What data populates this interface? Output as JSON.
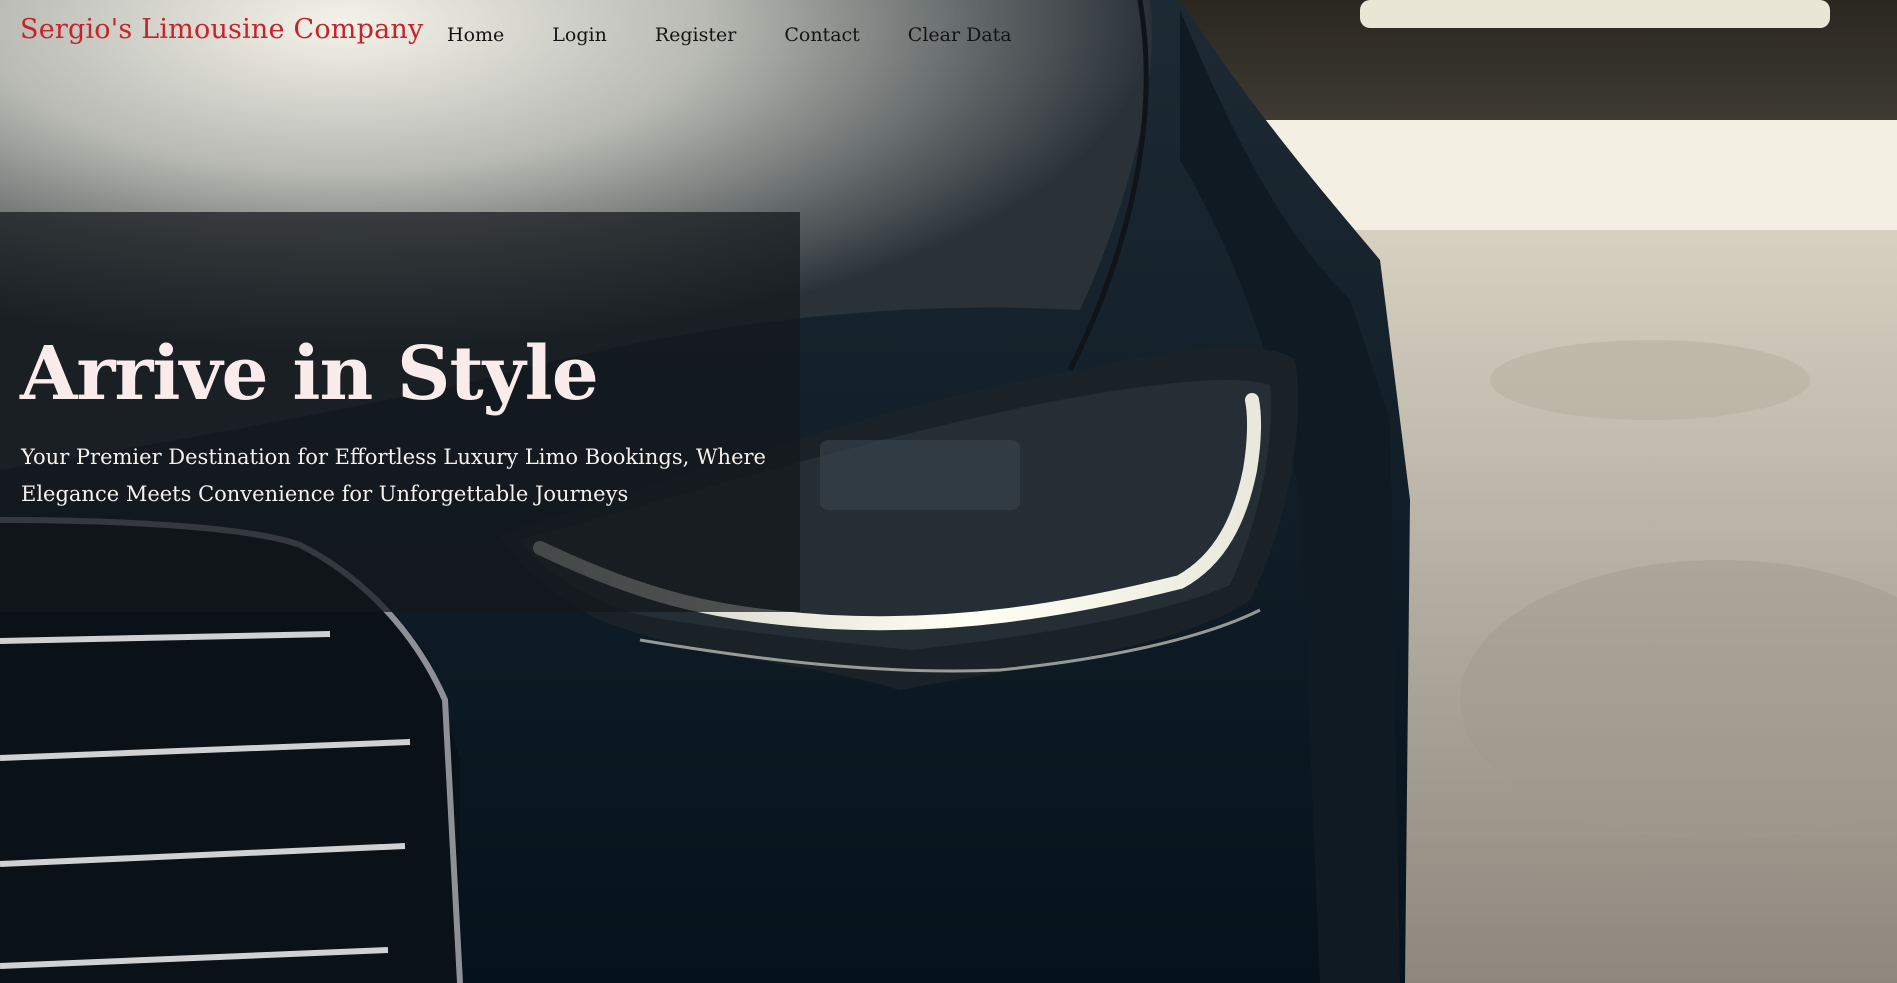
{
  "nav": {
    "brand": "Sergio's Limousine Company",
    "links": [
      {
        "label": "Home"
      },
      {
        "label": "Login"
      },
      {
        "label": "Register"
      },
      {
        "label": "Contact"
      },
      {
        "label": "Clear Data"
      }
    ]
  },
  "hero": {
    "title": "Arrive in Style",
    "subtitle": "Your Premier Destination for Effortless Luxury Limo Bookings, Where Elegance Meets Convenience for Unforgettable Journeys"
  },
  "colors": {
    "brand": "#c8222a",
    "nav_text": "#141414",
    "hero_title": "#fbecec",
    "hero_subtitle": "#f5f1ec",
    "panel": "#14181c"
  },
  "background_image": "car-headlight-photo"
}
